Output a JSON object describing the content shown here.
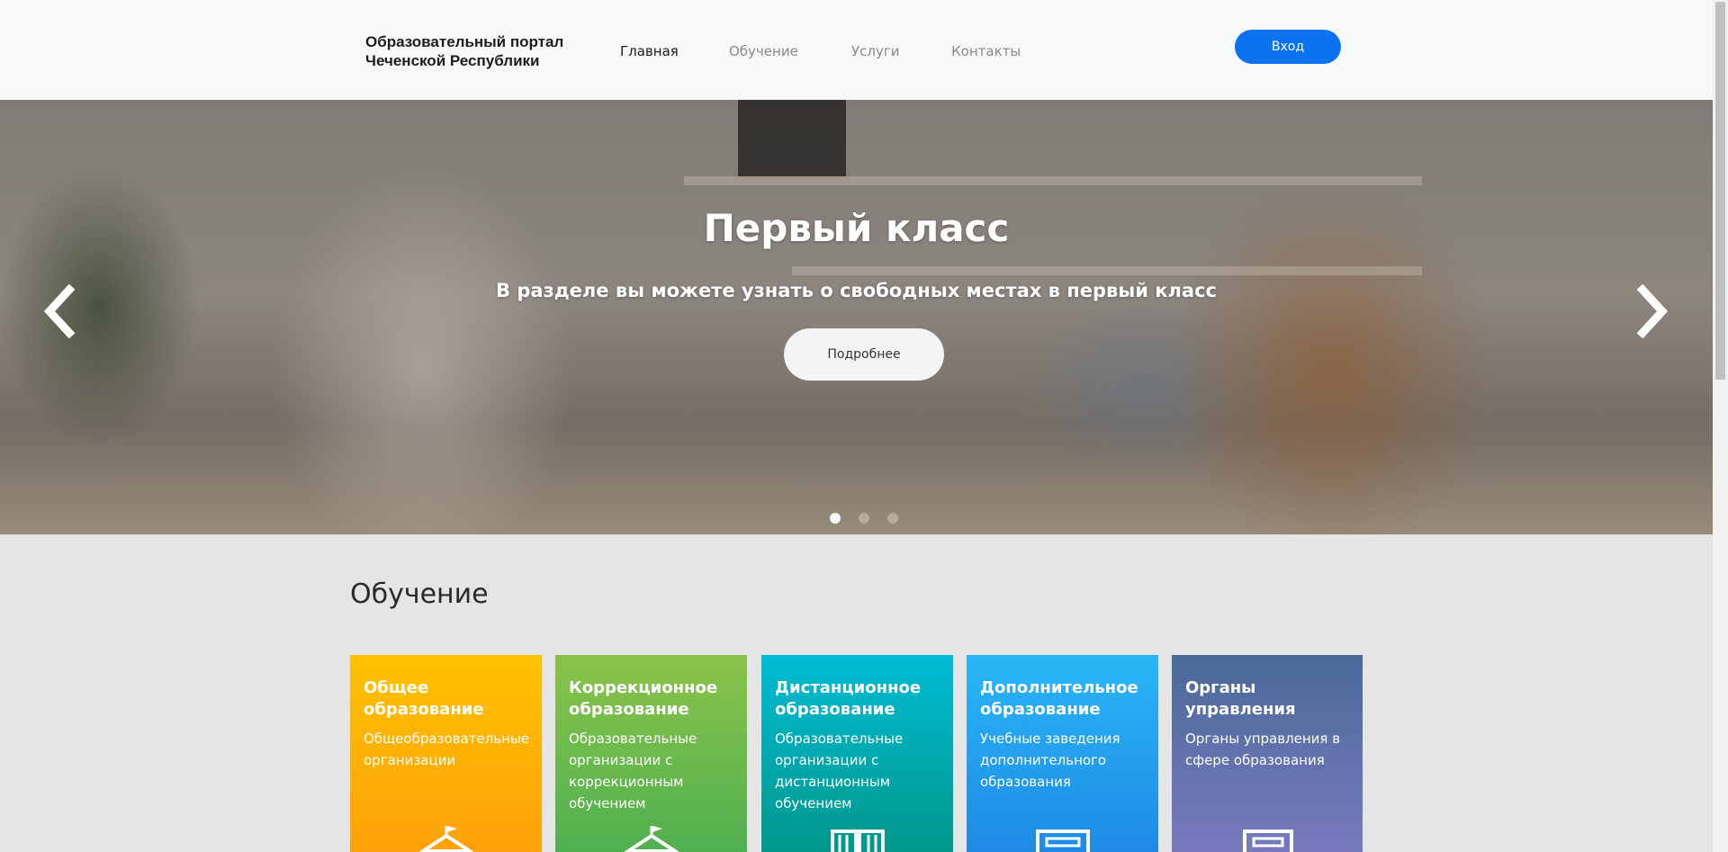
{
  "header": {
    "brand_line1": "Образовательный портал",
    "brand_line2": "Чеченской Республики",
    "nav": [
      {
        "label": "Главная",
        "active": true
      },
      {
        "label": "Обучение",
        "active": false
      },
      {
        "label": "Услуги",
        "active": false
      },
      {
        "label": "Контакты",
        "active": false
      }
    ],
    "login_label": "Вход"
  },
  "hero": {
    "title": "Первый класс",
    "subtitle": "В разделе вы можете узнать о свободных местах в первый класс",
    "button_label": "Подробнее",
    "slides_count": 3,
    "active_slide": 1,
    "prev_icon": "chevron-left-icon",
    "next_icon": "chevron-right-icon"
  },
  "education": {
    "title": "Обучение",
    "cards": [
      {
        "title": "Общее образование",
        "desc": "Общеобразовательные организации",
        "icon": "school-building-icon",
        "color_top": "#fec200",
        "color_bottom": "#ff9f0a"
      },
      {
        "title": "Коррекционное образование",
        "desc": "Образовательные организации с коррекционным обучением",
        "icon": "school-building-icon",
        "color_top": "#8bc34a",
        "color_bottom": "#4caf50"
      },
      {
        "title": "Дистанционное образование",
        "desc": "Образовательные организации с дистанционным обучением",
        "icon": "book-icon",
        "color_top": "#00bcd4",
        "color_bottom": "#009688"
      },
      {
        "title": "Дополнительное образование",
        "desc": "Учебные заведения дополнительного образования",
        "icon": "certificate-icon",
        "color_top": "#29b6f6",
        "color_bottom": "#1e88e5"
      },
      {
        "title": "Органы управления",
        "desc": "Органы управления в сфере образования",
        "icon": "document-icon",
        "color_top": "#4a6a9a",
        "color_bottom": "#7a7bbf"
      }
    ]
  },
  "colors": {
    "accent": "#0a73f0",
    "header_bg": "#f7f8fa",
    "page_bg": "#e5e5e5"
  }
}
